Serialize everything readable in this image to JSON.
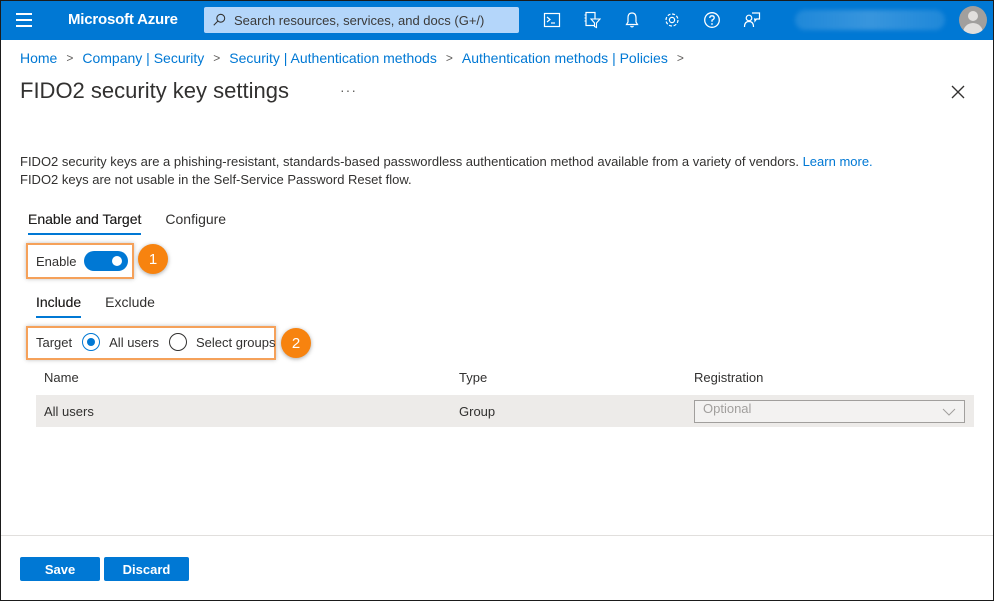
{
  "topbar": {
    "brand": "Microsoft Azure",
    "search_placeholder": "Search resources, services, and docs (G+/)",
    "icons": [
      "cloud-shell-icon",
      "directory-filter-icon",
      "notifications-icon",
      "settings-icon",
      "help-icon",
      "feedback-icon"
    ],
    "color": "#0078d4"
  },
  "breadcrumb": {
    "items": [
      "Home",
      "Company | Security",
      "Security | Authentication methods",
      "Authentication methods | Policies"
    ]
  },
  "page": {
    "title": "FIDO2 security key settings",
    "more_label": "···",
    "description_line1": "FIDO2 security keys are a phishing-resistant, standards-based passwordless authentication method available from a variety of vendors.",
    "learn_more": "Learn more.",
    "description_line2": "FIDO2 keys are not usable in the Self-Service Password Reset flow."
  },
  "tabs": [
    {
      "label": "Enable and Target",
      "active": true
    },
    {
      "label": "Configure",
      "active": false
    }
  ],
  "enable": {
    "label": "Enable",
    "on": true
  },
  "subtabs": [
    {
      "label": "Include",
      "active": true
    },
    {
      "label": "Exclude",
      "active": false
    }
  ],
  "target": {
    "label": "Target",
    "options": [
      {
        "label": "All users",
        "checked": true
      },
      {
        "label": "Select groups",
        "checked": false
      }
    ]
  },
  "annotations": [
    "1",
    "2"
  ],
  "table": {
    "headers": [
      "Name",
      "Type",
      "Registration"
    ],
    "rows": [
      {
        "name": "All users",
        "type": "Group",
        "registration": "Optional"
      }
    ]
  },
  "footer": {
    "save_label": "Save",
    "discard_label": "Discard"
  }
}
